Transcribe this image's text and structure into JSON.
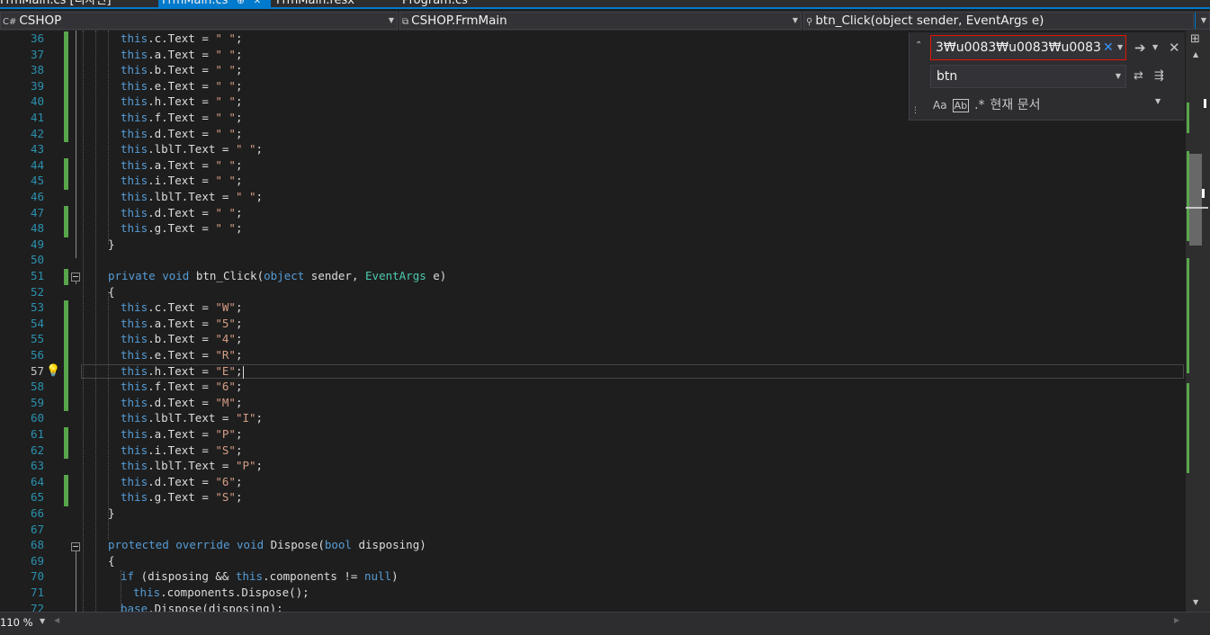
{
  "tabs": [
    {
      "label": "FrmMain.cs [디자인]"
    },
    {
      "label": "FrmMain.cs",
      "pin": "⊕",
      "close": "✕"
    },
    {
      "label": "FrmMain.resx"
    },
    {
      "label": "Program.cs"
    }
  ],
  "nav": {
    "project": "CSHOP",
    "class": "CSHOP.FrmMain",
    "member": "btn_Click(object sender, EventArgs e)",
    "project_icon": "C#"
  },
  "find": {
    "search_value": "3₩u0083₩u0083₩u0083",
    "replace_value": "btn",
    "scope": "현재 문서"
  },
  "status": {
    "zoom": "110 %"
  },
  "code": [
    {
      "n": "36",
      "t": "this.c.Text = \" \";"
    },
    {
      "n": "37",
      "t": "this.a.Text = \" \";"
    },
    {
      "n": "38",
      "t": "this.b.Text = \" \";"
    },
    {
      "n": "39",
      "t": "this.e.Text = \" \";"
    },
    {
      "n": "40",
      "t": "this.h.Text = \" \";"
    },
    {
      "n": "41",
      "t": "this.f.Text = \" \";"
    },
    {
      "n": "42",
      "t": "this.d.Text = \" \";"
    },
    {
      "n": "43",
      "t": "this.lblT.Text = \" \";"
    },
    {
      "n": "44",
      "t": "this.a.Text = \" \";"
    },
    {
      "n": "45",
      "t": "this.i.Text = \" \";"
    },
    {
      "n": "46",
      "t": "this.lblT.Text = \" \";"
    },
    {
      "n": "47",
      "t": "this.d.Text = \" \";"
    },
    {
      "n": "48",
      "t": "this.g.Text = \" \";"
    },
    {
      "n": "49",
      "t": "}"
    },
    {
      "n": "50",
      "t": ""
    },
    {
      "n": "51",
      "t": "private void btn_Click(object sender, EventArgs e)"
    },
    {
      "n": "52",
      "t": "{"
    },
    {
      "n": "53",
      "t": "this.c.Text = \"W\";"
    },
    {
      "n": "54",
      "t": "this.a.Text = \"5\";"
    },
    {
      "n": "55",
      "t": "this.b.Text = \"4\";"
    },
    {
      "n": "56",
      "t": "this.e.Text = \"R\";"
    },
    {
      "n": "57",
      "t": "this.h.Text = \"E\";"
    },
    {
      "n": "58",
      "t": "this.f.Text = \"6\";"
    },
    {
      "n": "59",
      "t": "this.d.Text = \"M\";"
    },
    {
      "n": "60",
      "t": "this.lblT.Text = \"I\";"
    },
    {
      "n": "61",
      "t": "this.a.Text = \"P\";"
    },
    {
      "n": "62",
      "t": "this.i.Text = \"S\";"
    },
    {
      "n": "63",
      "t": "this.lblT.Text = \"P\";"
    },
    {
      "n": "64",
      "t": "this.d.Text = \"6\";"
    },
    {
      "n": "65",
      "t": "this.g.Text = \"S\";"
    },
    {
      "n": "66",
      "t": "}"
    },
    {
      "n": "67",
      "t": ""
    },
    {
      "n": "68",
      "t": "protected override void Dispose(bool disposing)"
    },
    {
      "n": "69",
      "t": "{"
    },
    {
      "n": "70",
      "t": "if (disposing && this.components != null)"
    },
    {
      "n": "71",
      "t": "this.components.Dispose();"
    },
    {
      "n": "72",
      "t": "base.Dispose(disposing);"
    }
  ]
}
